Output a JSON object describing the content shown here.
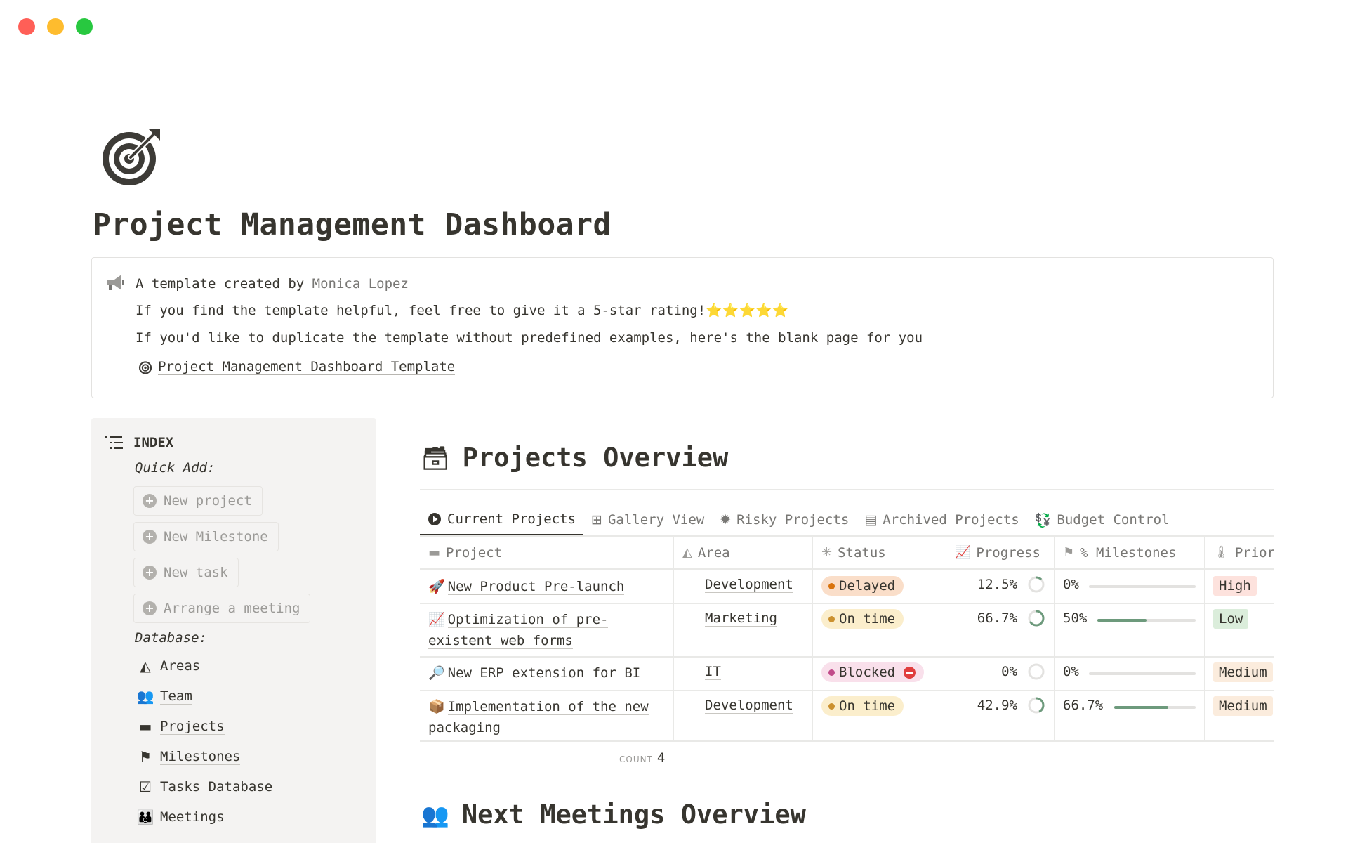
{
  "window": {
    "controls": [
      "close",
      "minimize",
      "maximize"
    ]
  },
  "page": {
    "icon": "target-icon",
    "title": "Project Management Dashboard"
  },
  "callout": {
    "icon": "megaphone-icon",
    "line1_prefix": "A template created by ",
    "author": "Monica Lopez",
    "line2": "If you find the template helpful, feel free to give it a 5-star rating!⭐⭐⭐⭐⭐",
    "line3": "If you'd like to duplicate the template without predefined examples, here's the blank page for you",
    "link_label": "Project Management Dashboard Template"
  },
  "sidebar": {
    "index_label": "INDEX",
    "quick_add_label": "Quick Add:",
    "quick_add": [
      "New project",
      "New Milestone",
      "New task",
      "Arrange a meeting"
    ],
    "database_label": "Database:",
    "database": [
      {
        "icon": "shapes-icon",
        "glyph": "◭",
        "label": "Areas"
      },
      {
        "icon": "team-icon",
        "glyph": "👥",
        "label": "Team"
      },
      {
        "icon": "folder-icon",
        "glyph": "▬",
        "label": "Projects"
      },
      {
        "icon": "flag-icon",
        "glyph": "⚑",
        "label": "Milestones"
      },
      {
        "icon": "checklist-icon",
        "glyph": "☑",
        "label": "Tasks Database"
      },
      {
        "icon": "meeting-people-icon",
        "glyph": "👪",
        "label": "Meetings"
      }
    ]
  },
  "projects": {
    "title": "Projects Overview",
    "title_emoji": "🗃",
    "tabs": [
      {
        "icon": "play-circle-icon",
        "glyph": "▶",
        "label": "Current Projects",
        "active": true
      },
      {
        "icon": "gallery-icon",
        "glyph": "⊞",
        "label": "Gallery View",
        "active": false
      },
      {
        "icon": "alert-badge-icon",
        "glyph": "✹",
        "label": "Risky Projects",
        "active": false
      },
      {
        "icon": "archive-icon",
        "glyph": "▤",
        "label": "Archived Projects",
        "active": false
      },
      {
        "icon": "money-icon",
        "glyph": "💱",
        "label": "Budget Control",
        "active": false
      }
    ],
    "columns": [
      {
        "icon": "folder-icon",
        "glyph": "▬",
        "label": "Project"
      },
      {
        "icon": "shapes-icon",
        "glyph": "◭",
        "label": "Area"
      },
      {
        "icon": "loading-icon",
        "glyph": "✳",
        "label": "Status"
      },
      {
        "icon": "chart-line-icon",
        "glyph": "📈",
        "label": "Progress"
      },
      {
        "icon": "flag-icon",
        "glyph": "⚑",
        "label": "% Milestones"
      },
      {
        "icon": "thermometer-icon",
        "glyph": "🌡",
        "label": "Priority"
      }
    ],
    "rows": [
      {
        "emoji": "🚀",
        "name": "New Product Pre-launch",
        "area": "Development",
        "status": "Delayed",
        "status_kind": "delayed",
        "progress": "12.5%",
        "progress_value": 0.125,
        "milestones": "0%",
        "milestones_value": 0,
        "priority": "High",
        "priority_kind": "high"
      },
      {
        "emoji": "📈",
        "name": "Optimization of pre-existent web forms",
        "area": "Marketing",
        "status": "On time",
        "status_kind": "ontime",
        "progress": "66.7%",
        "progress_value": 0.667,
        "milestones": "50%",
        "milestones_value": 0.5,
        "priority": "Low",
        "priority_kind": "low"
      },
      {
        "emoji": "🔎",
        "name": "New ERP extension for BI",
        "area": "IT",
        "status": "Blocked",
        "status_kind": "blocked",
        "progress": "0%",
        "progress_value": 0,
        "milestones": "0%",
        "milestones_value": 0,
        "priority": "Medium",
        "priority_kind": "medium"
      },
      {
        "emoji": "📦",
        "name": "Implementation of the new packaging",
        "area": "Development",
        "status": "On time",
        "status_kind": "ontime",
        "progress": "42.9%",
        "progress_value": 0.429,
        "milestones": "66.7%",
        "milestones_value": 0.667,
        "priority": "Medium",
        "priority_kind": "medium"
      }
    ],
    "count_label": "COUNT",
    "count_value": "4"
  },
  "meetings": {
    "title": "Next Meetings Overview",
    "title_emoji": "👥"
  },
  "colors": {
    "accent_green": "#6d9a7c",
    "delayed": "#d9730d",
    "on_time": "#cb912f",
    "blocked": "#c14c8a"
  }
}
